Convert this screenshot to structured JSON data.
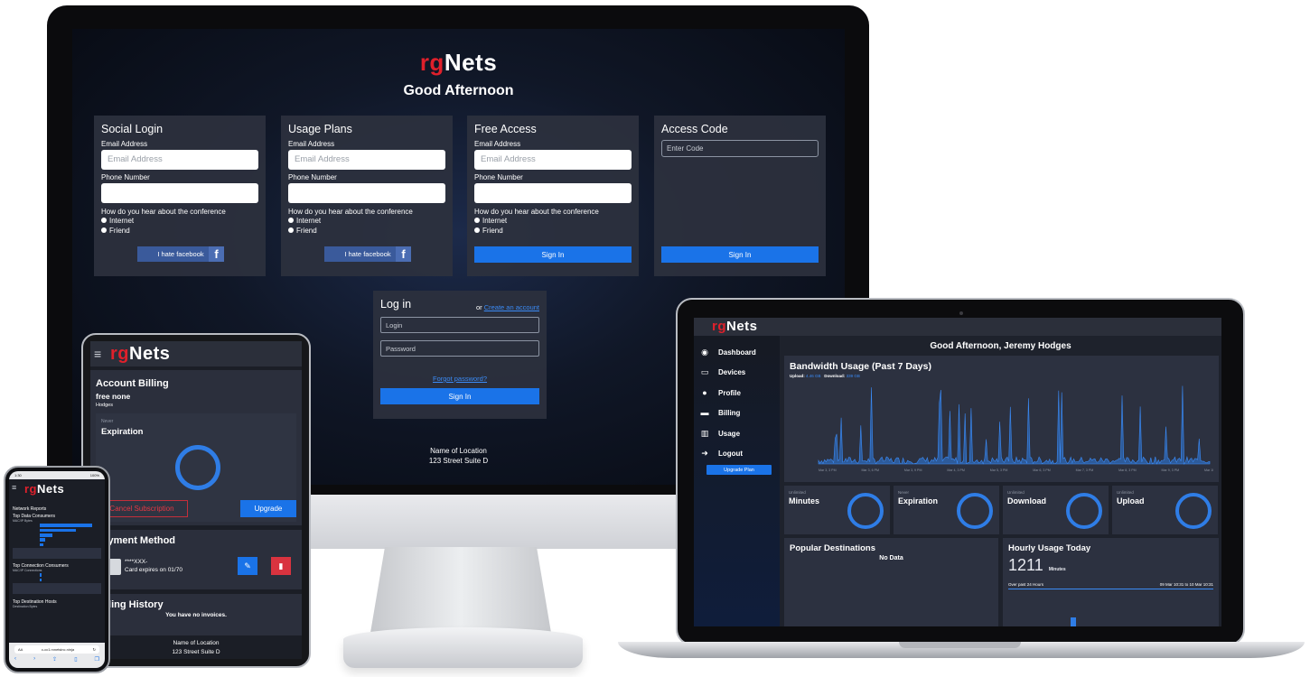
{
  "brand": {
    "rg": "rg",
    "name": "Nets"
  },
  "monitor": {
    "greeting": "Good Afternoon",
    "cards": [
      {
        "title": "Social Login",
        "email_label": "Email Address",
        "email_placeholder": "Email Address",
        "phone_label": "Phone Number",
        "question": "How do you hear about the conference",
        "options": [
          "Internet",
          "Friend"
        ],
        "button": "I hate facebook",
        "fb_icon": "f"
      },
      {
        "title": "Usage Plans",
        "email_label": "Email Address",
        "email_placeholder": "Email Address",
        "phone_label": "Phone Number",
        "question": "How do you hear about the conference",
        "options": [
          "Internet",
          "Friend"
        ],
        "button": "I hate facebook",
        "fb_icon": "f"
      },
      {
        "title": "Free Access",
        "email_label": "Email Address",
        "email_placeholder": "Email Address",
        "phone_label": "Phone Number",
        "question": "How do you hear about the conference",
        "options": [
          "Internet",
          "Friend"
        ],
        "button": "Sign In"
      },
      {
        "title": "Access Code",
        "code_placeholder": "Enter Code",
        "button": "Sign In"
      }
    ],
    "login": {
      "title": "Log in",
      "or_text": "or ",
      "create_link": "Create an account",
      "login_placeholder": "Login",
      "password_placeholder": "Password",
      "forgot": "Forgot password?",
      "button": "Sign In"
    },
    "address": [
      "Name of Location",
      "123 Street Suite D"
    ]
  },
  "laptop": {
    "greeting": "Good Afternoon, Jeremy Hodges",
    "nav": [
      {
        "label": "Dashboard",
        "icon": "dashboard-icon",
        "glyph": "◉"
      },
      {
        "label": "Devices",
        "icon": "monitor-icon",
        "glyph": "▭"
      },
      {
        "label": "Profile",
        "icon": "user-icon",
        "glyph": "●"
      },
      {
        "label": "Billing",
        "icon": "card-icon",
        "glyph": "▬"
      },
      {
        "label": "Usage",
        "icon": "chart-icon",
        "glyph": "▥"
      },
      {
        "label": "Logout",
        "icon": "logout-icon",
        "glyph": "➜"
      }
    ],
    "upgrade_button": "Upgrade Plan",
    "bandwidth": {
      "title": "Bandwidth Usage (Past 7 Days)",
      "upload_label": "Upload:",
      "upload_value": "4.46 GB",
      "download_label": "Download:",
      "download_value": "339 GB",
      "x_ticks": [
        "Mar 3, 3 PM",
        "Mar 3, 6 PM",
        "Mar 3, 9 PM",
        "Mar 4, 3 PM",
        "Mar 5, 3 PM",
        "Mar 6, 3 PM",
        "Mar 7, 3 PM",
        "Mar 8, 3 PM",
        "Mar 9, 3 PM",
        "Mar 10, 3 PM"
      ]
    },
    "stats": [
      {
        "small": "Unlimited",
        "big": "Minutes"
      },
      {
        "small": "Never",
        "big": "Expiration"
      },
      {
        "small": "Unlimited",
        "big": "Download"
      },
      {
        "small": "Unlimited",
        "big": "Upload"
      }
    ],
    "popular": {
      "title": "Popular Destinations",
      "empty": "No Data"
    },
    "hourly": {
      "title": "Hourly Usage Today",
      "value": "1211",
      "unit": "Minutes",
      "period": "Over past 24 Hours",
      "range": "09 Mar 10:31 to 10 Mar 10:31"
    }
  },
  "tablet": {
    "billing": {
      "title": "Account Billing",
      "plan": "free none",
      "user": "Hodges",
      "small": "Never",
      "big": "Expiration",
      "cancel": "Cancel Subscription",
      "upgrade": "Upgrade"
    },
    "payment": {
      "title": "Payment Method",
      "card": "****XXX-",
      "expires": "Card expires on 01/70"
    },
    "history": {
      "title": "Billing History",
      "empty": "You have no invoices."
    },
    "address": [
      "Name of Location",
      "123 Street Suite D"
    ]
  },
  "phone": {
    "time": "1:30",
    "battery": "100%",
    "title": "Network Reports",
    "top_data": "Top Data Consumers",
    "top_data_label": "MAC/IP Bytes",
    "top_conn": "Top Connection Consumers",
    "top_conn_label": "MAC/IP Connections",
    "top_dest": "Top Destination Hosts",
    "top_dest_label": "Destination Bytes",
    "url": "c-cc1.rxnetsinc.ninja",
    "url_left": "AA",
    "refresh_glyph": "↻"
  }
}
